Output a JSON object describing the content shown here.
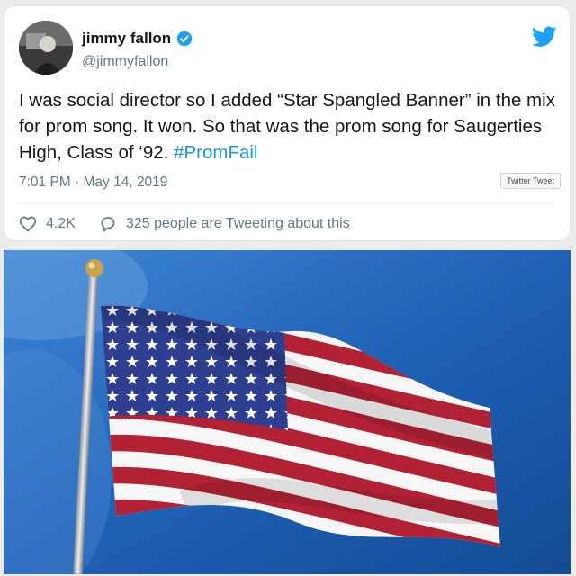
{
  "tweet": {
    "author_name": "jimmy fallon",
    "handle": "@jimmyfallon",
    "text_main": "I was social director so I added “Star Spangled Banner” in the mix for prom song. It won. So that was the prom song for Saugerties High, Class of ‘92.",
    "hashtag": "#PromFail",
    "timestamp": "7:01 PM · May 14, 2019",
    "embed_badge": "Twitter Tweet",
    "likes": "4.2K",
    "conversation": "325 people are Tweeting about this"
  },
  "colors": {
    "accent": "#1b95e0",
    "secondary_text": "#657786",
    "sky": "#1f62b5",
    "flag_red": "#b22234",
    "flag_blue": "#3c3b6e"
  },
  "icons": [
    "verified-badge-icon",
    "twitter-bird-icon",
    "heart-icon",
    "reply-bubble-icon"
  ]
}
